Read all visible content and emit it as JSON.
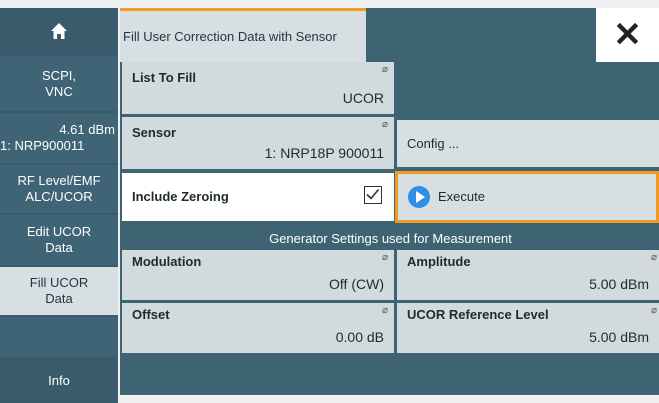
{
  "sidebar": {
    "items": [
      {
        "label": "",
        "icon": "home-icon"
      },
      {
        "line1": "SCPI,",
        "line2": "VNC"
      },
      {
        "line1": "4.61 dBm",
        "line2": "1: NRP900011"
      },
      {
        "line1": "RF Level/EMF",
        "line2": "ALC/UCOR"
      },
      {
        "line1": "Edit UCOR",
        "line2": "Data"
      },
      {
        "line1": "Fill UCOR",
        "line2": "Data"
      },
      {
        "line1": "",
        "line2": ""
      },
      {
        "line1": "Info",
        "line2": ""
      }
    ]
  },
  "dialog": {
    "title": "Fill User Correction Data with Sensor",
    "close_label": "✕"
  },
  "fields": {
    "list_to_fill": {
      "label": "List To Fill",
      "value": "UCOR"
    },
    "sensor": {
      "label": "Sensor",
      "value": "1: NRP18P 900011"
    },
    "config": {
      "label": "Config ..."
    },
    "include_zeroing": {
      "label": "Include Zeroing",
      "checked": true
    },
    "execute": {
      "label": "Execute"
    }
  },
  "generator_settings": {
    "header": "Generator Settings used for Measurement",
    "modulation": {
      "label": "Modulation",
      "value": "Off (CW)"
    },
    "amplitude": {
      "label": "Amplitude",
      "value": "5.00 dBm"
    },
    "offset": {
      "label": "Offset",
      "value": "0.00 dB"
    },
    "ucor_reference_level": {
      "label": "UCOR Reference Level",
      "value": "5.00 dBm"
    }
  },
  "colors": {
    "accent": "#f29b1e",
    "sidebar": "#3f6475",
    "execute_icon": "#2d8ee8"
  }
}
